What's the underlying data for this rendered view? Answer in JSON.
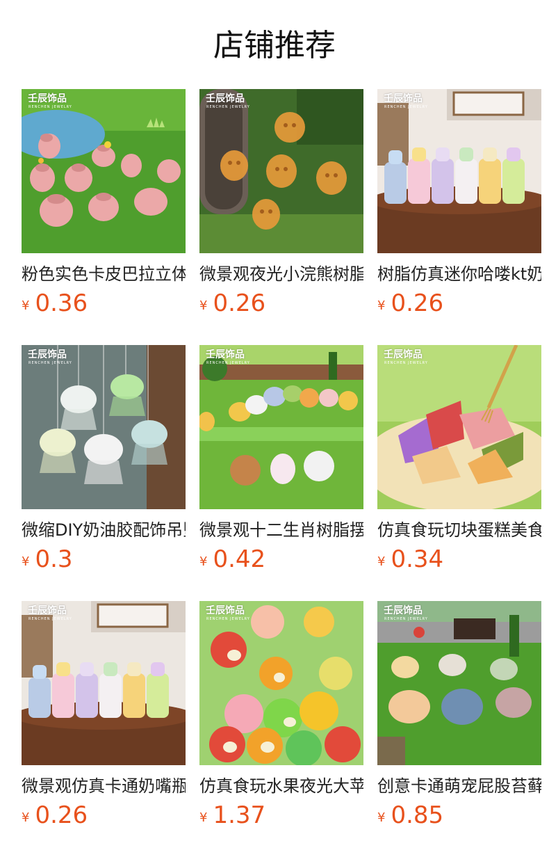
{
  "title": "店铺推荐",
  "brand": {
    "name": "壬辰饰品",
    "sub": "RENCHEN JEWELRY"
  },
  "currency_symbol": "¥",
  "products": [
    {
      "name": "粉色实色卡皮巴拉立体",
      "price": "0.36",
      "image": "pink capybara figurines on grass"
    },
    {
      "name": "微景观夜光小浣熊树脂",
      "price": "0.26",
      "image": "glowing raccoon figurines"
    },
    {
      "name": "树脂仿真迷你哈喽kt奶瓶",
      "price": "0.26",
      "image": "hello kitty mini bottles"
    },
    {
      "name": "微缩DIY奶油胶配饰吊坠",
      "price": "0.3",
      "image": "glowing bear pendants"
    },
    {
      "name": "微景观十二生肖树脂摆件",
      "price": "0.42",
      "image": "zodiac animal figurines"
    },
    {
      "name": "仿真食玩切块蛋糕美食",
      "price": "0.34",
      "image": "cake slices miniature"
    },
    {
      "name": "微景观仿真卡通奶嘴瓶",
      "price": "0.26",
      "image": "hello kitty bottles"
    },
    {
      "name": "仿真食玩水果夜光大苹果",
      "price": "1.37",
      "image": "glowing fruit apples"
    },
    {
      "name": "创意卡通萌宠屁股苔藓",
      "price": "0.85",
      "image": "cartoon pet butt figurines"
    }
  ]
}
